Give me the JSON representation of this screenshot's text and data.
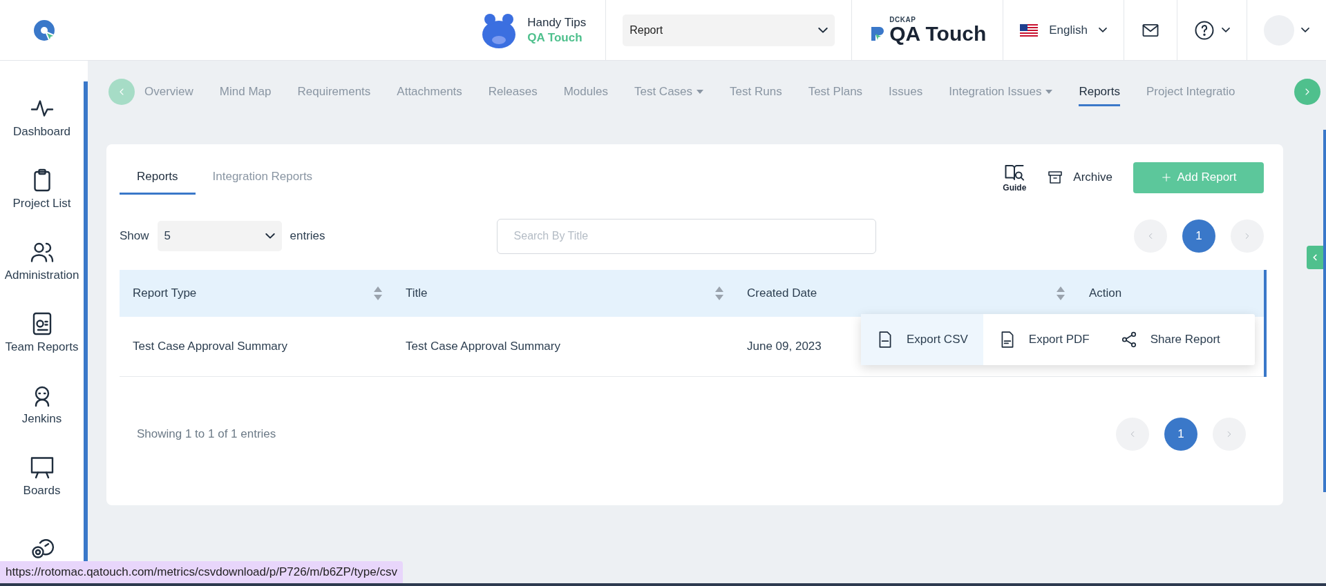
{
  "header": {
    "tips": {
      "title": "Handy Tips",
      "subtitle": "QA Touch"
    },
    "module_select": {
      "value": "Report"
    },
    "brand": {
      "company": "DCKAP",
      "product": "QA Touch"
    },
    "language": {
      "label": "English"
    }
  },
  "sidebar": {
    "items": [
      {
        "label": "Dashboard",
        "kind": "pulse"
      },
      {
        "label": "Project List",
        "kind": "clipboard"
      },
      {
        "label": "Administration",
        "kind": "users"
      },
      {
        "label": "Team Reports",
        "kind": "report"
      },
      {
        "label": "Jenkins",
        "kind": "person"
      },
      {
        "label": "Boards",
        "kind": "board"
      },
      {
        "kind": "gear"
      }
    ]
  },
  "project_tabs": [
    {
      "label": "Overview",
      "selected": false,
      "dropdown": false
    },
    {
      "label": "Mind Map",
      "selected": false,
      "dropdown": false
    },
    {
      "label": "Requirements",
      "selected": false,
      "dropdown": false
    },
    {
      "label": "Attachments",
      "selected": false,
      "dropdown": false
    },
    {
      "label": "Releases",
      "selected": false,
      "dropdown": false
    },
    {
      "label": "Modules",
      "selected": false,
      "dropdown": false
    },
    {
      "label": "Test Cases",
      "selected": false,
      "dropdown": true
    },
    {
      "label": "Test Runs",
      "selected": false,
      "dropdown": false
    },
    {
      "label": "Test Plans",
      "selected": false,
      "dropdown": false
    },
    {
      "label": "Issues",
      "selected": false,
      "dropdown": false
    },
    {
      "label": "Integration Issues",
      "selected": false,
      "dropdown": true
    },
    {
      "label": "Reports",
      "selected": true,
      "dropdown": false
    },
    {
      "label": "Project Integratio",
      "selected": false,
      "dropdown": false
    }
  ],
  "report_tabs": [
    {
      "label": "Reports",
      "selected": true
    },
    {
      "label": "Integration Reports",
      "selected": false
    }
  ],
  "toolbar": {
    "guide": "Guide",
    "archive": "Archive",
    "add": "Add Report"
  },
  "entries": {
    "show": "Show",
    "value": "5",
    "suffix": "entries"
  },
  "search": {
    "placeholder": "Search By Title"
  },
  "pagination_top": {
    "pages": [
      {
        "label": "1",
        "selected": true
      }
    ]
  },
  "table": {
    "columns": [
      {
        "label": "Report Type",
        "sortable": true
      },
      {
        "label": "Title",
        "sortable": true
      },
      {
        "label": "Created Date",
        "sortable": true
      },
      {
        "label": "Action",
        "sortable": false
      }
    ],
    "rows": [
      {
        "cells": [
          "Test Case Approval Summary",
          "Test Case Approval Summary",
          "June 09, 2023"
        ]
      }
    ]
  },
  "action_menu": {
    "items": [
      {
        "label": "Export CSV",
        "kind": "csv",
        "selected": true
      },
      {
        "label": "Export PDF",
        "kind": "pdf",
        "selected": false
      },
      {
        "label": "Share Report",
        "kind": "share",
        "selected": false
      }
    ]
  },
  "footer": {
    "summary": "Showing 1 to 1 of 1 entries",
    "pages": [
      {
        "label": "1",
        "selected": true
      }
    ]
  },
  "status_url": "https://rotomac.qatouch.com/metrics/csvdownload/p/P726/m/b6ZP/type/csv"
}
